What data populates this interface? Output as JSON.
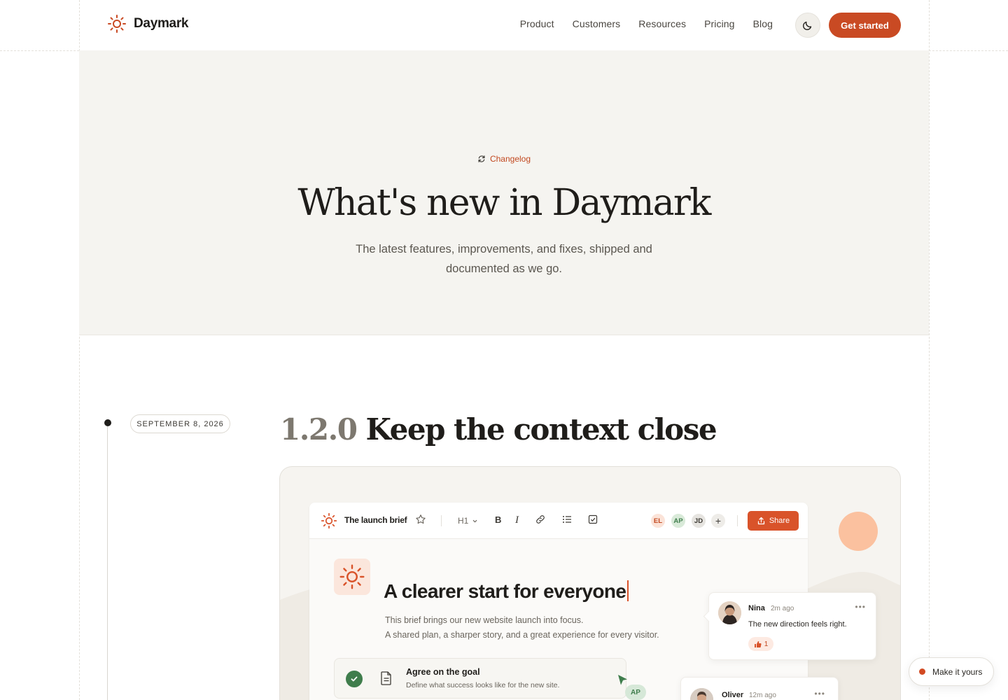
{
  "brand": {
    "name": "Daymark",
    "accent": "#c94a23"
  },
  "nav": {
    "items": [
      "Product",
      "Customers",
      "Resources",
      "Pricing",
      "Blog"
    ]
  },
  "header": {
    "theme_toggle_icon": "moon-icon",
    "cta_label": "Get started"
  },
  "hero": {
    "tag": "Changelog",
    "title": "What's new in Daymark",
    "subtitle_line1": "The latest features, improvements, and fixes, shipped and",
    "subtitle_line2": "documented as we go."
  },
  "release": {
    "date": "SEPTEMBER 8, 2026",
    "version": "1.2.0",
    "title": "Keep the context close"
  },
  "editor": {
    "doc_name": "The launch brief",
    "heading_select": "H1",
    "collaborators": [
      {
        "initials": "EL",
        "bg": "#fbe3d8",
        "fg": "#c2481f"
      },
      {
        "initials": "AP",
        "bg": "#d9ead9",
        "fg": "#3f7d4c"
      },
      {
        "initials": "JD",
        "bg": "#e6e4e0",
        "fg": "#3d3a35"
      }
    ],
    "add_collaborator": "+",
    "share_label": "Share",
    "heading": "A clearer start for everyone",
    "body_line1": "This brief brings our new website launch into focus.",
    "body_line2": "A shared plan, a sharper story, and a great experience for every visitor.",
    "task": {
      "title": "Agree on the goal",
      "subtitle": "Define what success looks like for the new site."
    },
    "cursor_tag": "AP"
  },
  "comments": [
    {
      "name": "Nina",
      "time": "2m ago",
      "text": "The new direction feels right.",
      "likes": "1"
    },
    {
      "name": "Oliver",
      "time": "12m ago"
    }
  ],
  "floating": {
    "label": "Make it yours"
  }
}
